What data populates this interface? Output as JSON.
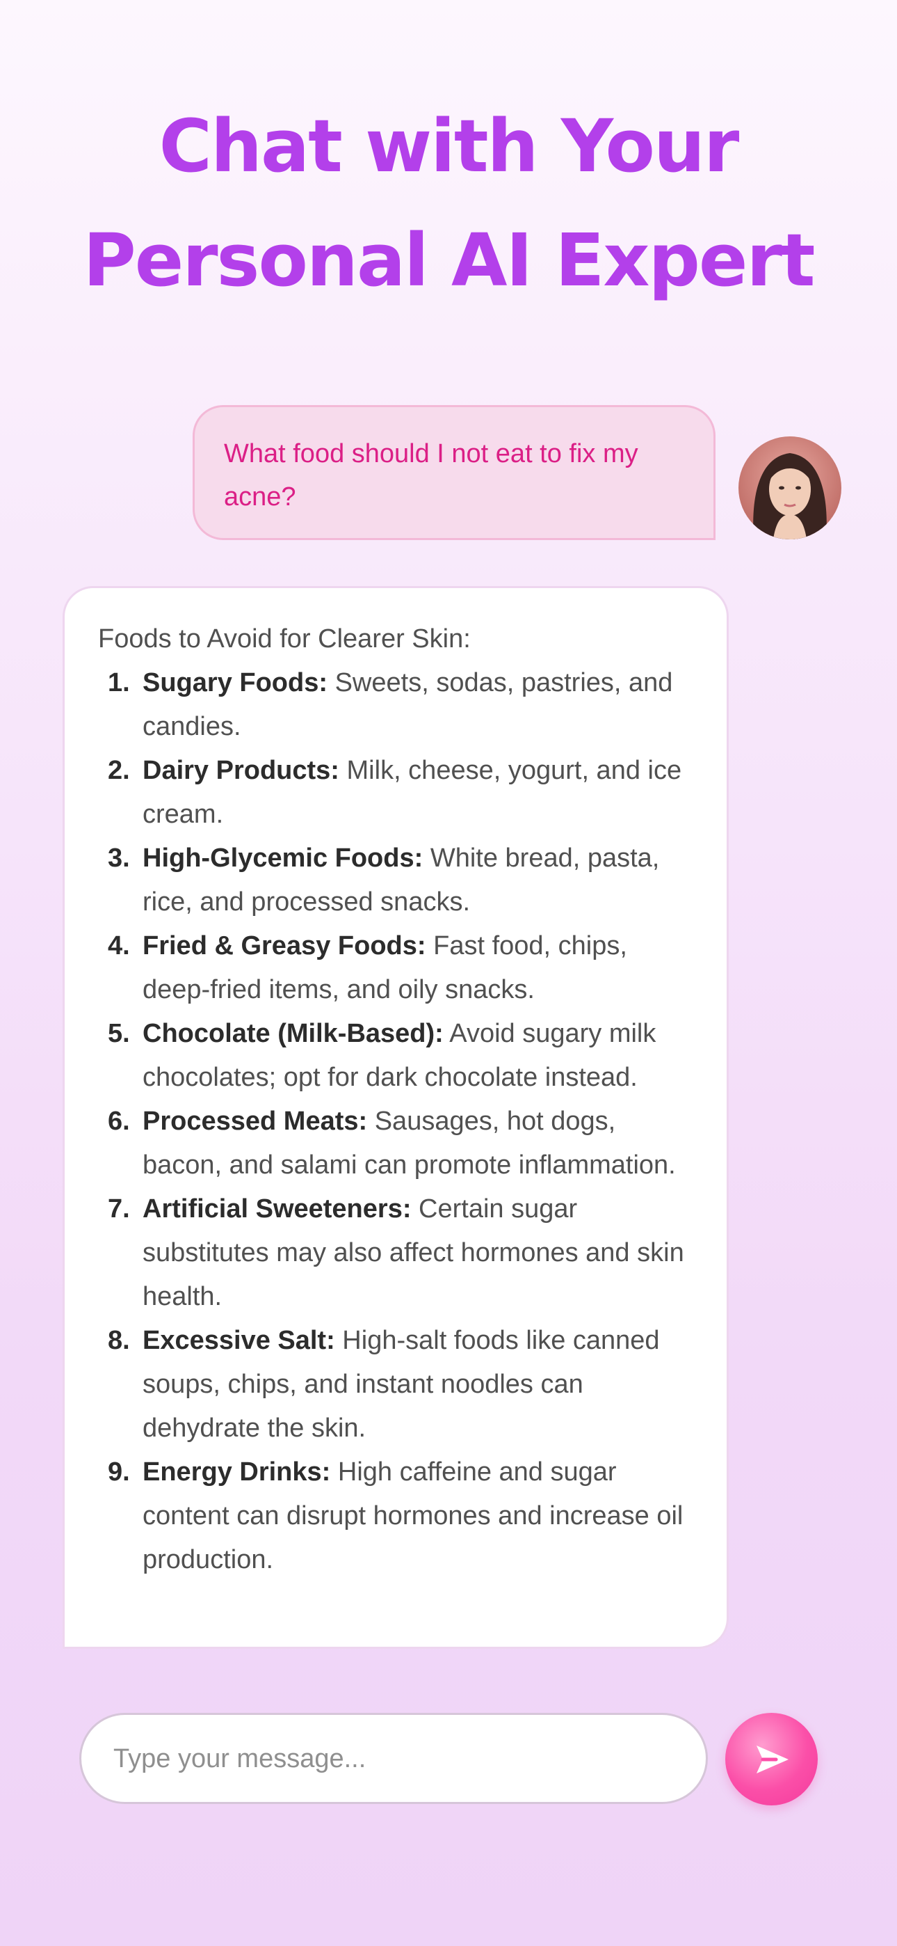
{
  "header": {
    "title_line1": "Chat with Your",
    "title_line2": "Personal AI Expert"
  },
  "user_message": {
    "text": "What food should I not eat to fix my acne?",
    "avatar_icon": "user-avatar-photo"
  },
  "ai_response": {
    "intro": "Foods to Avoid for Clearer Skin:",
    "items": [
      {
        "num": "1.",
        "title": "Sugary Foods:",
        "text": " Sweets, sodas, pastries, and candies."
      },
      {
        "num": "2.",
        "title": "Dairy Products:",
        "text": " Milk, cheese, yogurt, and ice cream."
      },
      {
        "num": "3.",
        "title": "High-Glycemic Foods:",
        "text": " White bread, pasta, rice, and processed snacks."
      },
      {
        "num": "4.",
        "title": "Fried & Greasy Foods:",
        "text": " Fast food, chips, deep-fried items, and oily snacks."
      },
      {
        "num": "5.",
        "title": "Chocolate (Milk-Based):",
        "text": " Avoid sugary milk chocolates; opt for dark chocolate instead."
      },
      {
        "num": "6.",
        "title": "Processed Meats:",
        "text": " Sausages, hot dogs, bacon, and salami can promote inflammation."
      },
      {
        "num": "7.",
        "title": "Artificial Sweeteners:",
        "text": " Certain sugar substitutes may also affect hormones and skin health."
      },
      {
        "num": "8.",
        "title": "Excessive Salt:",
        "text": " High-salt foods like canned soups, chips, and instant noodles can dehydrate the skin."
      },
      {
        "num": "9.",
        "title": "Energy Drinks:",
        "text": " High caffeine and sugar content can disrupt hormones and increase oil production."
      }
    ]
  },
  "composer": {
    "placeholder": "Type your message...",
    "value": "",
    "send_icon": "send-icon"
  },
  "colors": {
    "headline": "#b340ea",
    "user_bubble_bg": "#f7dbec",
    "user_text": "#db1f86",
    "send_button": "#fb4fa8"
  }
}
